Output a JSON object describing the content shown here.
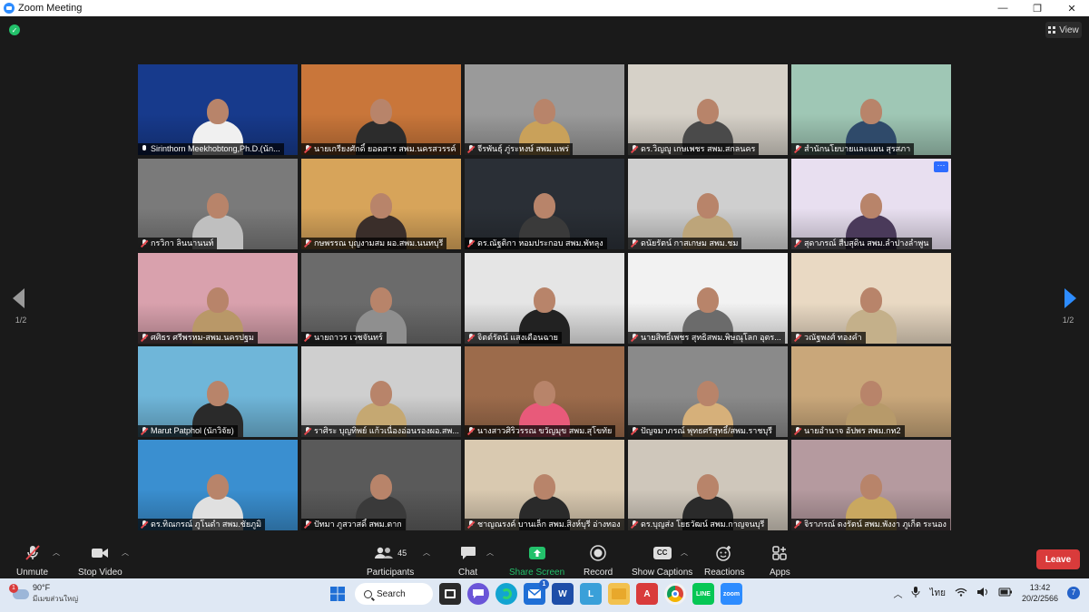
{
  "window": {
    "title": "Zoom Meeting",
    "minimize": "—",
    "restore": "❐",
    "close": "✕"
  },
  "view_button": {
    "label": "View"
  },
  "pager": {
    "left": "1/2",
    "right": "1/2"
  },
  "tiles": [
    {
      "name": "Sirinthorn Meekhobtong,Ph.D.(นัก...",
      "muted": false,
      "active": true,
      "bg": "#173a8c",
      "body": "#f0f0f0"
    },
    {
      "name": "นายเกรียงศักดิ์ ยอดสาร สพม.นครสวรรค์",
      "muted": true,
      "bg": "#c9763a",
      "body": "#2c2c2c"
    },
    {
      "name": "จีรพันธุ์ ภู่ระหงษ์ สพม.แพร่",
      "muted": true,
      "bg": "#9a9a9a",
      "body": "#c9a15a"
    },
    {
      "name": "ดร.วิญญู เกษเพชร สพม.สกลนคร",
      "muted": true,
      "bg": "#d6d1c8",
      "body": "#4a4a4a"
    },
    {
      "name": "สำนักนโยบายและแผน สุรสภา",
      "muted": true,
      "bg": "#9fc7b5",
      "body": "#2f4a6a"
    },
    {
      "name": "กรวิกา ลินนานนท์",
      "muted": true,
      "bg": "#7a7a7a",
      "body": "#bfbfbf"
    },
    {
      "name": "กษพรรณ บุญงามสม ผอ.สพม.นนทบุรี",
      "muted": true,
      "bg": "#d7a45a",
      "body": "#3a2e2a"
    },
    {
      "name": "ดร.ณัฐติกา หอมประกอบ สพม.พัทลุง",
      "muted": true,
      "bg": "#2a2f36",
      "body": "#3a3a3a"
    },
    {
      "name": "ดนัยรัตน์ กาสเกษม สพม.ชม",
      "muted": true,
      "bg": "#cfcfcf",
      "body": "#bda57a"
    },
    {
      "name": "สุดาภรณ์ สืบสุดิน สพม.ลำปางลำพูน",
      "muted": true,
      "bg": "#e8dff0",
      "body": "#4a3a5a",
      "more": "···"
    },
    {
      "name": "ศศิธร ศรีพรหม-สพม.นครปฐม",
      "muted": true,
      "bg": "#d9a1ad",
      "body": "#b99868"
    },
    {
      "name": "นายถาวร เวชจันทร์",
      "muted": true,
      "bg": "#6b6b6b",
      "body": "#8f8f8f"
    },
    {
      "name": "จิตต์รัตน์ แสงเดือนฉาย",
      "muted": true,
      "bg": "#e5e5e5",
      "body": "#222222"
    },
    {
      "name": "นายสิทธิ์เพชร สุทธิสพม.พิษณุโลก อุตร...",
      "muted": true,
      "bg": "#f2f2f2",
      "body": "#6b6b6b"
    },
    {
      "name": "วณัฐพงศ์ ทองคำ",
      "muted": true,
      "bg": "#e9d9c3",
      "body": "#c4b08a"
    },
    {
      "name": "Marut Patphol (นักวิจัย)",
      "muted": true,
      "bg": "#6fb6d9",
      "body": "#2a2a2a"
    },
    {
      "name": "ราศิระ บุญทิพย์ แก้วเนื่องอ่อนรองผอ.สพ...",
      "muted": true,
      "bg": "#cfcfcf",
      "body": "#c5a872"
    },
    {
      "name": "นางสาวศิริวรรณ ขวัญมุข สพม.สุโขทัย",
      "muted": true,
      "bg": "#9c6b4b",
      "body": "#e85a7a"
    },
    {
      "name": "ปัญจมาภรณ์ พุทธศรีสุทธิ์/สพม.ราชบุรี",
      "muted": true,
      "bg": "#8a8a8a",
      "body": "#d6b07a"
    },
    {
      "name": "นายอำนาจ อัปพร สพม.กท2",
      "muted": true,
      "bg": "#c9a77a",
      "body": "#b79a6a"
    },
    {
      "name": "ดร.ทิณกรณ์ ภูโนดำ สพม.ชัยภูมิ",
      "muted": true,
      "bg": "#3a8fd0",
      "body": "#e0e0e0"
    },
    {
      "name": "ปัทมา ภูสวาสดิ์ สพม.ตาก",
      "muted": true,
      "bg": "#5a5a5a",
      "body": "#3a3a3a"
    },
    {
      "name": "ชาญณรงค์ บานเล็ก สพม.สิงห์บุรี อ่างทอง",
      "muted": true,
      "bg": "#d9c9b0",
      "body": "#2a2a2a"
    },
    {
      "name": "ดร.บุญส่ง โยธวัฒน์ สพม.กาญจนบุรี",
      "muted": true,
      "bg": "#cfc7bb",
      "body": "#2a2a2a"
    },
    {
      "name": "จิราภรณ์ ดงรัตน์ สพม.พังงา ภูเก็ต ระนอง",
      "muted": true,
      "bg": "#b59a9f",
      "body": "#c9a860"
    }
  ],
  "toolbar": {
    "unmute": "Unmute",
    "stop_video": "Stop Video",
    "participants": "Participants",
    "participants_count": "45",
    "chat": "Chat",
    "share_screen": "Share Screen",
    "record": "Record",
    "show_captions": "Show Captions",
    "captions_icon": "CC",
    "reactions": "Reactions",
    "apps": "Apps",
    "leave": "Leave",
    "share_color": "#23c16b"
  },
  "taskbar": {
    "temperature": "90°F",
    "weather_text": "มีเมฆส่วนใหญ่",
    "weather_badge": "1",
    "search": "Search",
    "mail_badge": "1",
    "language": "ไทย",
    "time": "13:42",
    "date": "20/2/2566",
    "notifications": "7"
  }
}
